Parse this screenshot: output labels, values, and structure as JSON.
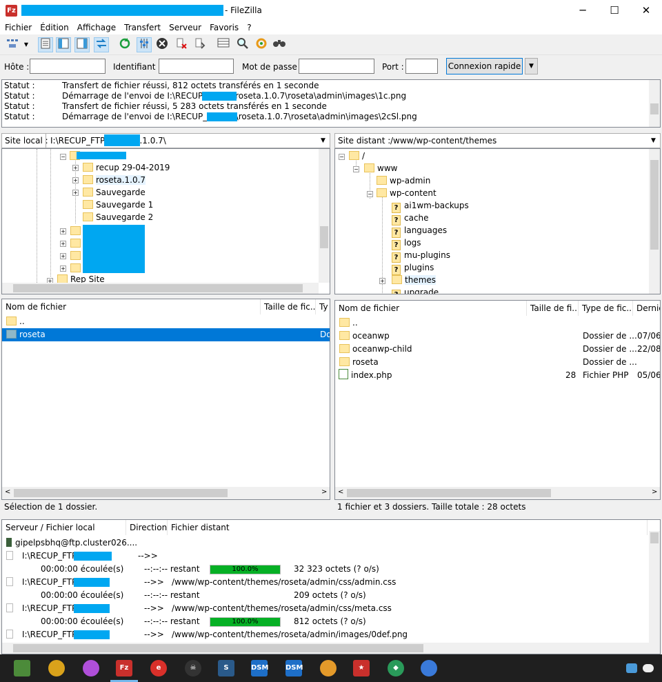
{
  "window": {
    "title": "- FileZilla",
    "app_icon": "Fz",
    "minimize": "─",
    "maximize": "☐",
    "close": "✕"
  },
  "menu": [
    "Fichier",
    "Édition",
    "Affichage",
    "Transfert",
    "Serveur",
    "Favoris",
    "?"
  ],
  "quickconnect": {
    "host_label": "Hôte :",
    "user_label": "Identifiant :",
    "pass_label": "Mot de passe :",
    "port_label": "Port :",
    "connect_label": "Connexion rapide"
  },
  "log": [
    {
      "k": "Statut :",
      "v": "Transfert de fichier réussi, 812 octets transférés en 1 seconde"
    },
    {
      "k": "Statut :",
      "v": "Démarrage de l'envoi de I:\\RECUP_FTP\\                  3\\roseta.1.0.7\\roseta\\admin\\images\\1c.png"
    },
    {
      "k": "Statut :",
      "v": "Transfert de fichier réussi, 5 283 octets transférés en 1 seconde"
    },
    {
      "k": "Statut :",
      "v": "Démarrage de l'envoi de I:\\RECUP_FTP\\(                 3\\roseta.1.0.7\\roseta\\admin\\images\\2cSl.png"
    }
  ],
  "local": {
    "label": "Site local :",
    "path": "I:\\RECUP_FTP\\(               roseta.1.0.7\\",
    "tree": [
      "recup 29-04-2019",
      "roseta.1.0.7",
      "Sauvegarde",
      "Sauvegarde 1",
      "Sauvegarde 2",
      "Rep Site"
    ],
    "columns": [
      "Nom de fichier",
      "Taille de fic...",
      "Ty"
    ],
    "files": [
      {
        "name": ".."
      },
      {
        "name": "roseta",
        "type": "Do"
      }
    ],
    "status": "Sélection de 1 dossier."
  },
  "remote": {
    "label": "Site distant :",
    "path": "/www/wp-content/themes",
    "tree": [
      "/",
      "www",
      "wp-admin",
      "wp-content",
      "ai1wm-backups",
      "cache",
      "languages",
      "logs",
      "mu-plugins",
      "plugins",
      "themes",
      "upgrade"
    ],
    "columns": [
      "Nom de fichier",
      "Taille de fi...",
      "Type de fic...",
      "Derniè"
    ],
    "files": [
      {
        "name": "..",
        "size": "",
        "type": "",
        "date": ""
      },
      {
        "name": "oceanwp",
        "size": "",
        "type": "Dossier de ...",
        "date": "07/06/"
      },
      {
        "name": "oceanwp-child",
        "size": "",
        "type": "Dossier de ...",
        "date": "22/08/"
      },
      {
        "name": "roseta",
        "size": "",
        "type": "Dossier de ...",
        "date": ""
      },
      {
        "name": "index.php",
        "size": "28",
        "type": "Fichier PHP",
        "date": "05/06/"
      }
    ],
    "status": "1 fichier et 3 dossiers. Taille totale : 28 octets"
  },
  "queue": {
    "columns": [
      "Serveur / Fichier local",
      "Direction",
      "Fichier distant"
    ],
    "server": "gipelpsbhq@ftp.cluster026....",
    "items": [
      {
        "local": "I:\\RECUP_FTP\\               .r...",
        "dir": "-->>",
        "remote": "",
        "elapsed": "00:00:00 écoulée(s)",
        "remaining": "--:--:-- restant",
        "progress_label": "100.0%",
        "progress": 100,
        "bytes": "32 323 octets (? o/s)"
      },
      {
        "local": "I:\\RECUP_FTP\\               \\r...",
        "dir": "-->>",
        "remote": "/www/wp-content/themes/roseta/admin/css/admin.css",
        "elapsed": "00:00:00 écoulée(s)",
        "remaining": "--:--:-- restant",
        "progress_label": "",
        "progress": 0,
        "bytes": "209 octets (? o/s)"
      },
      {
        "local": "I:\\RECUP_FTP\\               \\r...",
        "dir": "-->>",
        "remote": "/www/wp-content/themes/roseta/admin/css/meta.css",
        "elapsed": "00:00:00 écoulée(s)",
        "remaining": "--:--:-- restant",
        "progress_label": "100.0%",
        "progress": 100,
        "bytes": "812 octets (? o/s)"
      },
      {
        "local": "I:\\RECUP_FTP\\               \\r...",
        "dir": "-->>",
        "remote": "/www/wp-content/themes/roseta/admin/images/0def.png"
      }
    ]
  },
  "colors": {
    "accent": "#0078d7",
    "progress": "#06b025",
    "redaction": "#00a7f1"
  }
}
